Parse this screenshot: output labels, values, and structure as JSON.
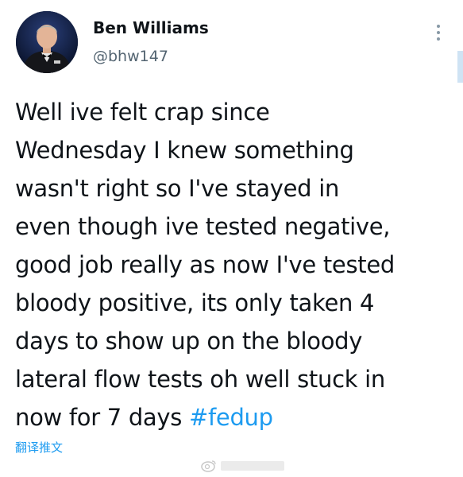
{
  "author": {
    "name": "Ben Williams",
    "handle": "@bhw147"
  },
  "tweet": {
    "lines": [
      "Well ive felt crap since",
      "Wednesday I knew something",
      "wasn't right so I've stayed in",
      "even though ive tested negative,",
      "good job really as now I've tested",
      "bloody positive, its only taken 4",
      "days to show up on the bloody",
      "lateral flow tests oh well stuck in",
      "now for 7 days "
    ],
    "hashtag": "#fedup"
  },
  "translate_label": "翻译推文",
  "watermark_text": "@微博",
  "colors": {
    "text": "#0f1419",
    "secondary": "#536471",
    "link": "#1d9bf0",
    "background": "#ffffff"
  },
  "icons": {
    "more": "more-vertical-icon",
    "watermark": "weibo-watermark-icon"
  }
}
